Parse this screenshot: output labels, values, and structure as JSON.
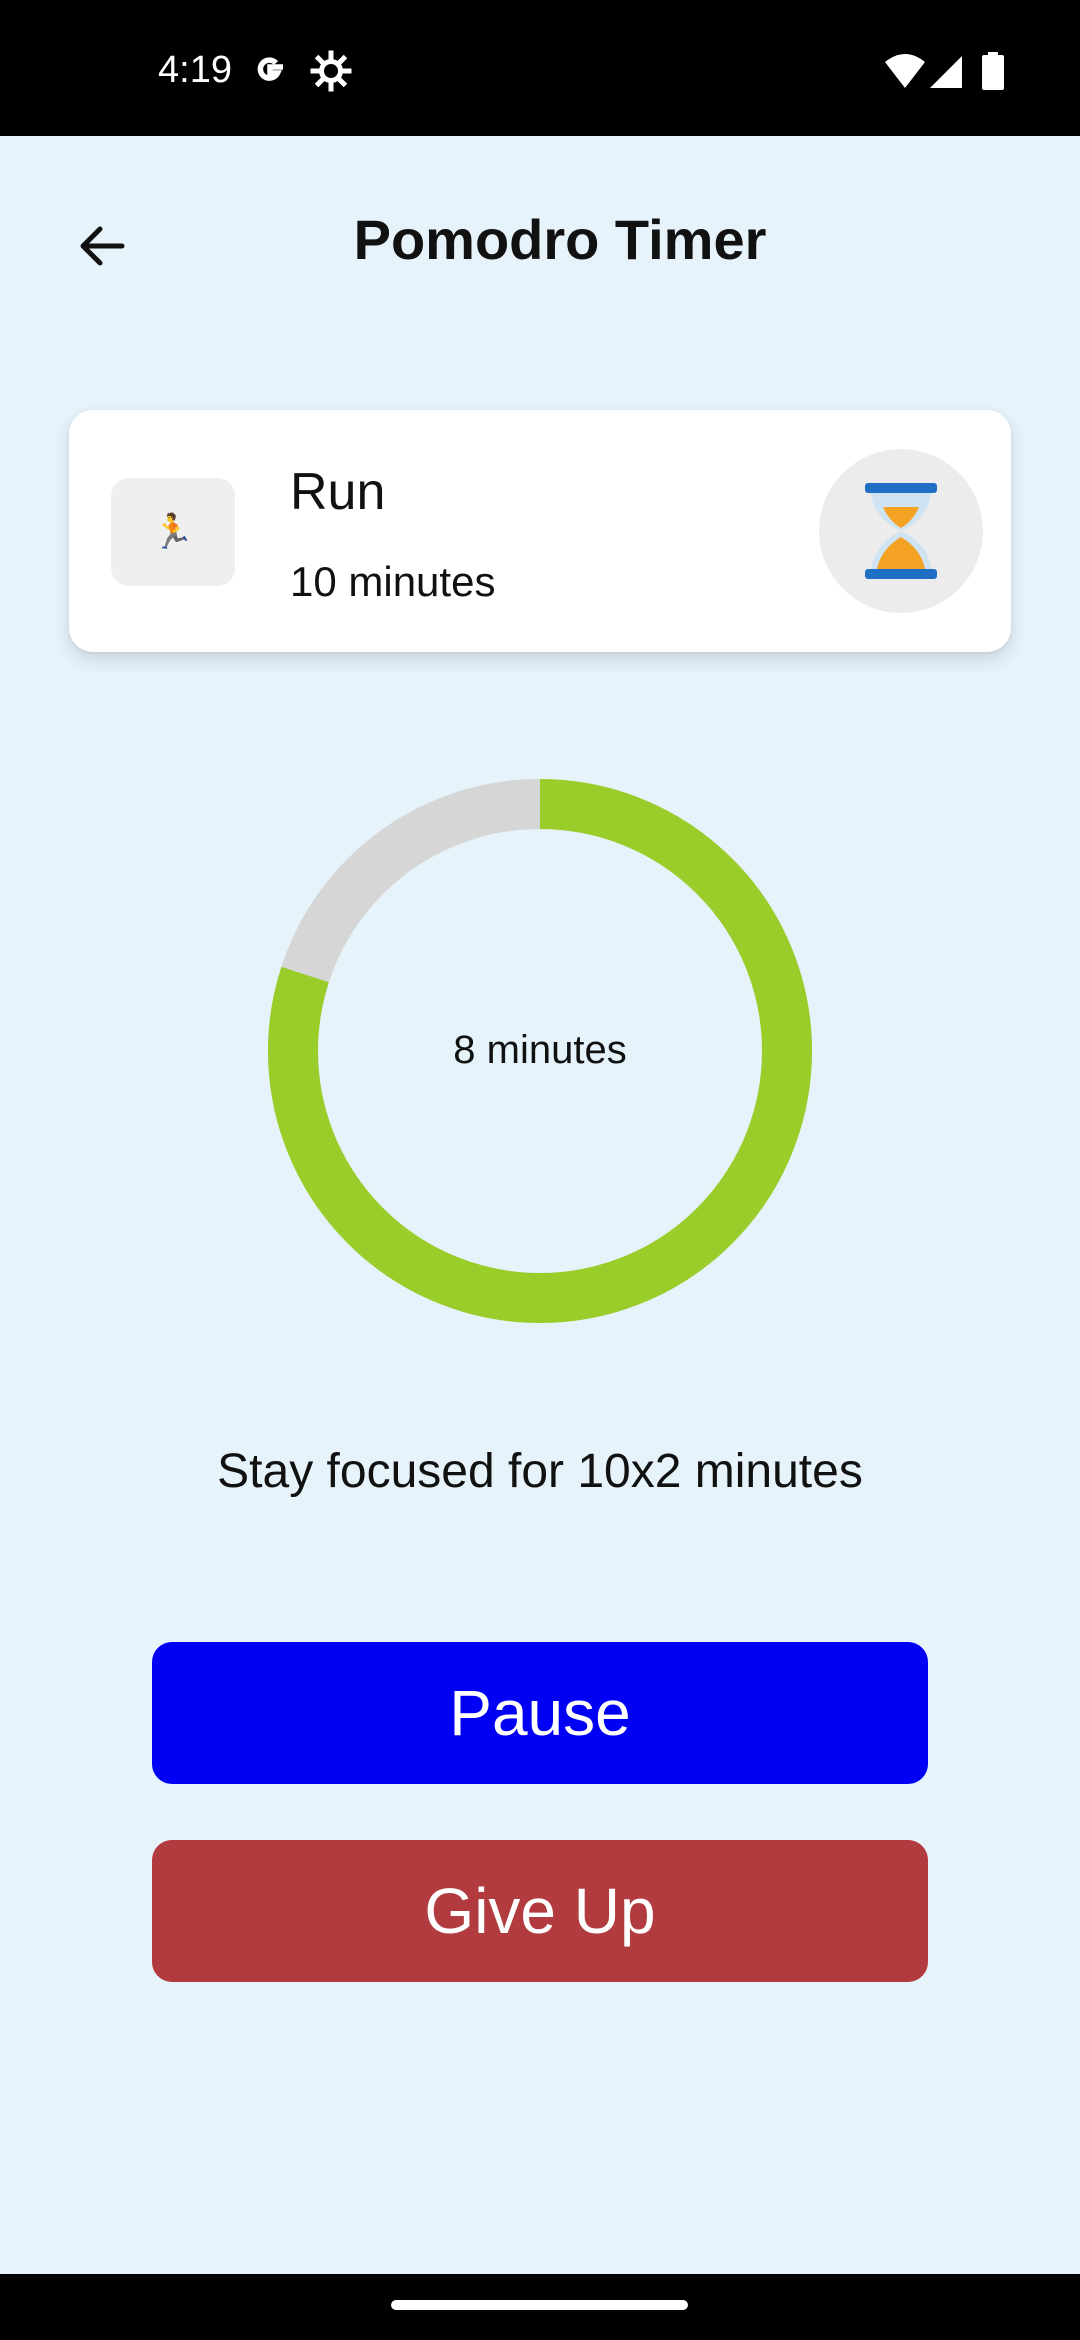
{
  "status_bar": {
    "time": "4:19",
    "icons": [
      "google-icon",
      "settings-gear-icon",
      "wifi-icon",
      "signal-icon",
      "battery-icon"
    ]
  },
  "header": {
    "title": "Pomodro Timer",
    "back_icon": "arrow-left-icon"
  },
  "task": {
    "emoji": "🏃",
    "name": "Run",
    "duration": "10 minutes",
    "action_icon": "hourglass-icon"
  },
  "timer": {
    "remaining_label": "8 minutes",
    "progress_fraction": 0.8,
    "progress_color": "#9acd2a",
    "track_color": "#d6d6d6"
  },
  "message": "Stay focused for 10x2 minutes",
  "actions": {
    "pause_label": "Pause",
    "give_up_label": "Give Up",
    "pause_color": "#0000f4",
    "give_up_color": "#b13b3e"
  },
  "theme": {
    "background": "#e6f3fb"
  }
}
